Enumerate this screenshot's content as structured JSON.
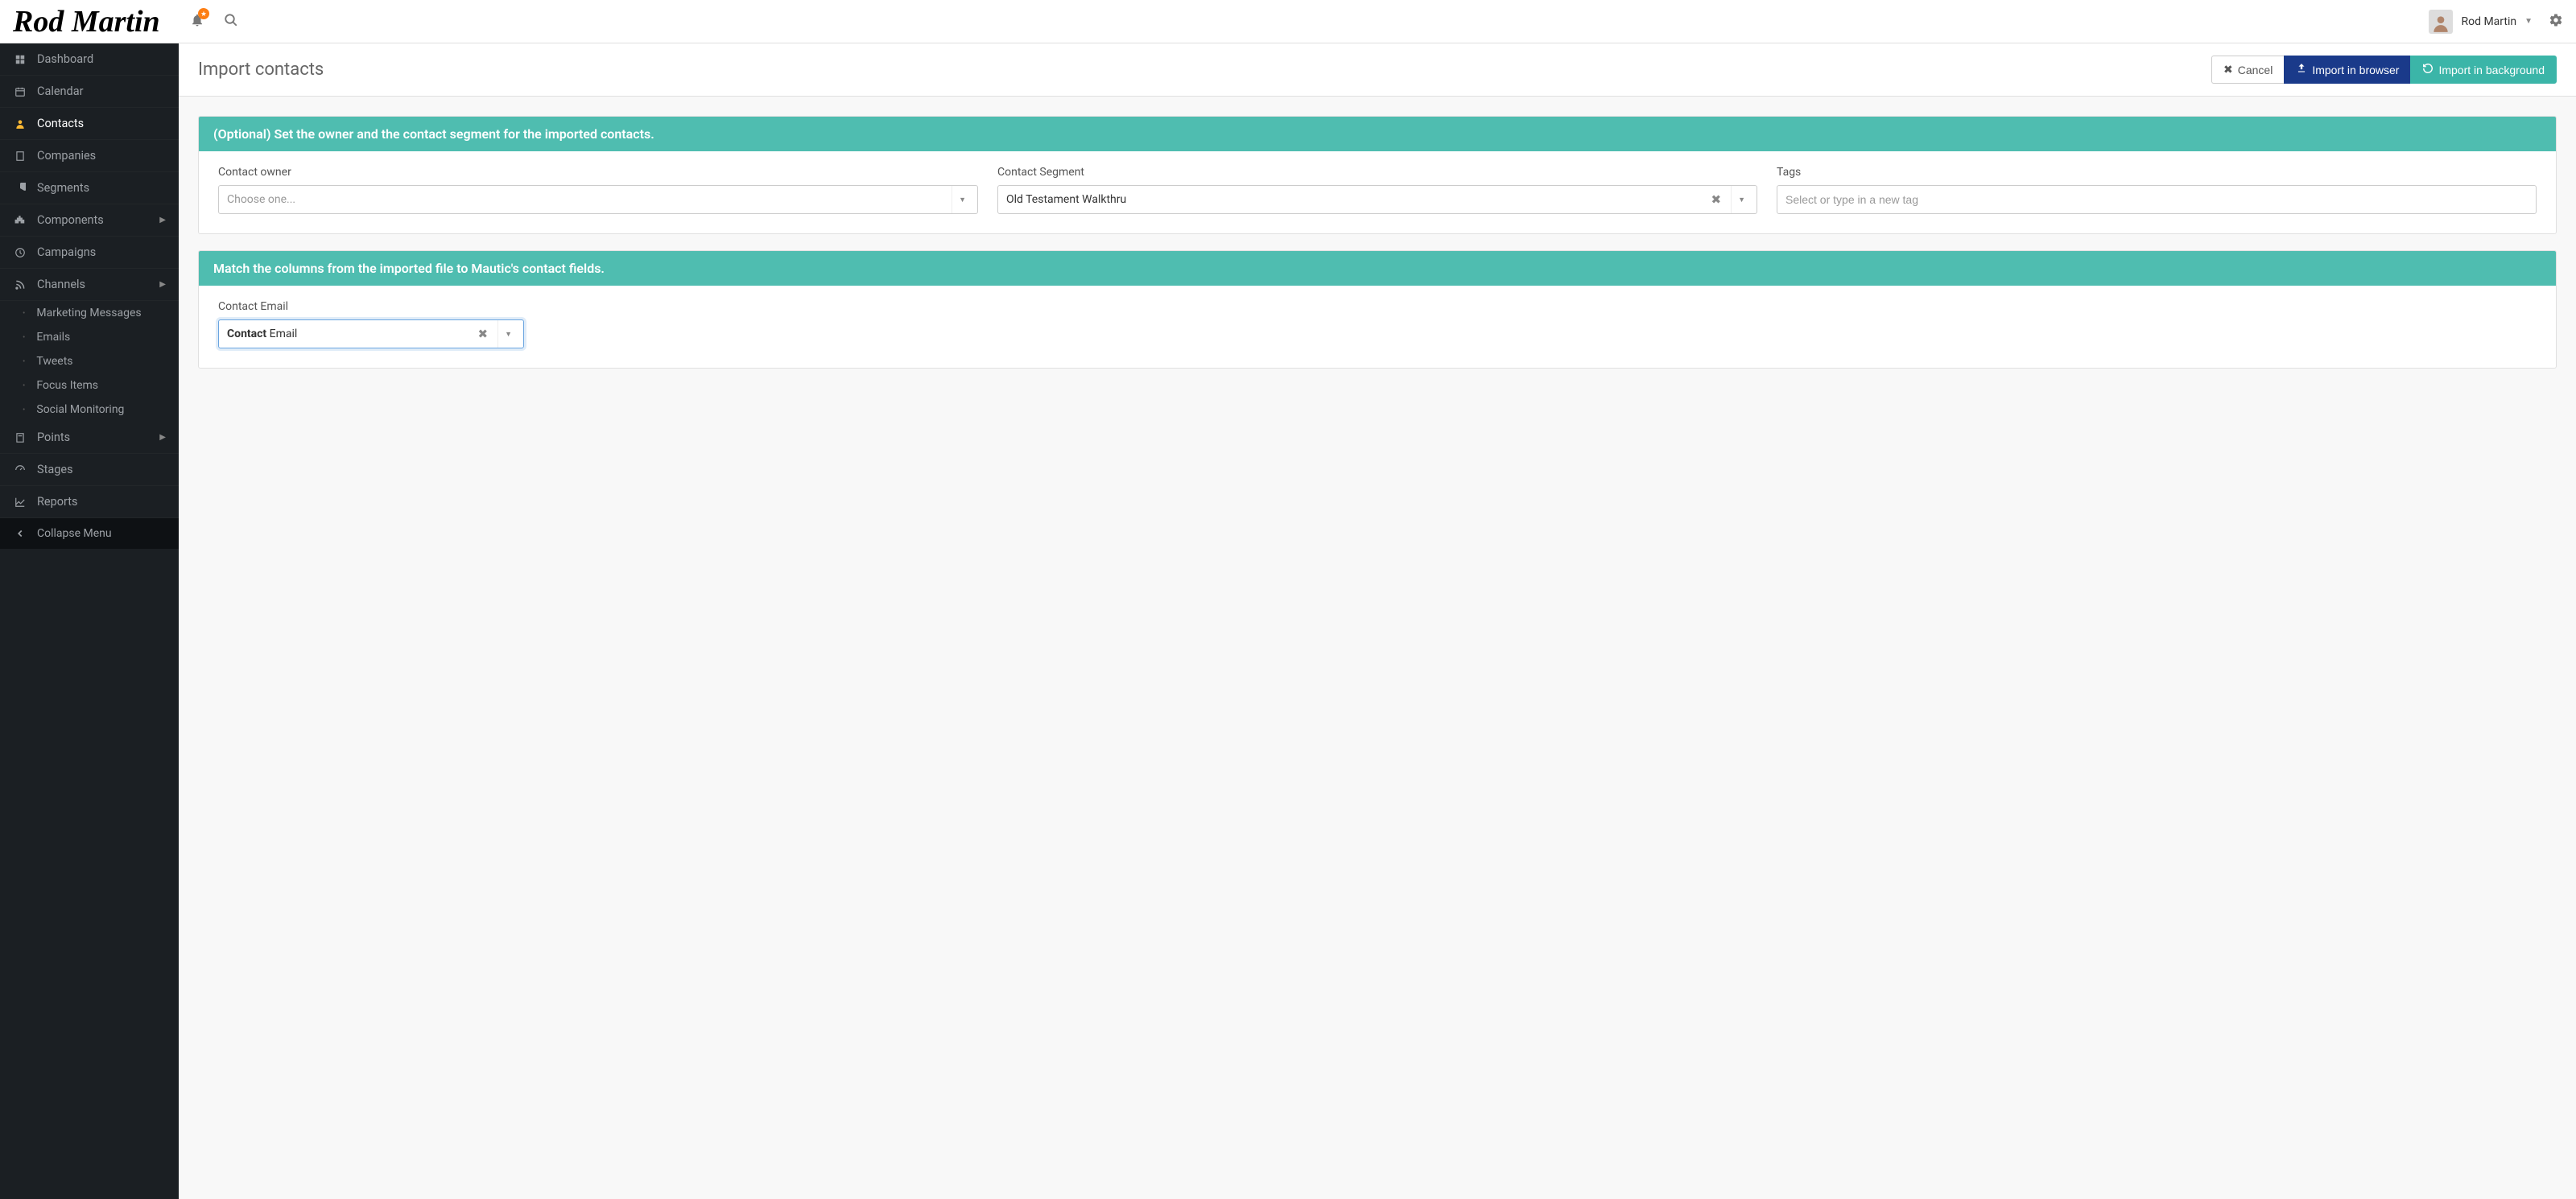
{
  "brand": "Rod Martin",
  "user": {
    "name": "Rod Martin"
  },
  "sidebar": {
    "items": [
      {
        "label": "Dashboard"
      },
      {
        "label": "Calendar"
      },
      {
        "label": "Contacts"
      },
      {
        "label": "Companies"
      },
      {
        "label": "Segments"
      },
      {
        "label": "Components"
      },
      {
        "label": "Campaigns"
      },
      {
        "label": "Channels"
      },
      {
        "label": "Points"
      },
      {
        "label": "Stages"
      },
      {
        "label": "Reports"
      }
    ],
    "channelsSub": [
      {
        "label": "Marketing Messages"
      },
      {
        "label": "Emails"
      },
      {
        "label": "Tweets"
      },
      {
        "label": "Focus Items"
      },
      {
        "label": "Social Monitoring"
      }
    ],
    "collapse": "Collapse Menu"
  },
  "page": {
    "title": "Import contacts",
    "actions": {
      "cancel": "Cancel",
      "importBrowser": "Import in browser",
      "importBackground": "Import in background"
    }
  },
  "panel1": {
    "heading": "(Optional) Set the owner and the contact segment for the imported contacts.",
    "owner": {
      "label": "Contact owner",
      "placeholder": "Choose one..."
    },
    "segment": {
      "label": "Contact Segment",
      "value": "Old Testament Walkthru"
    },
    "tags": {
      "label": "Tags",
      "placeholder": "Select or type in a new tag"
    }
  },
  "panel2": {
    "heading": "Match the columns from the imported file to Mautic's contact fields.",
    "field": {
      "label": "Contact Email",
      "valueBold": "Contact",
      "valueRest": " Email"
    }
  }
}
